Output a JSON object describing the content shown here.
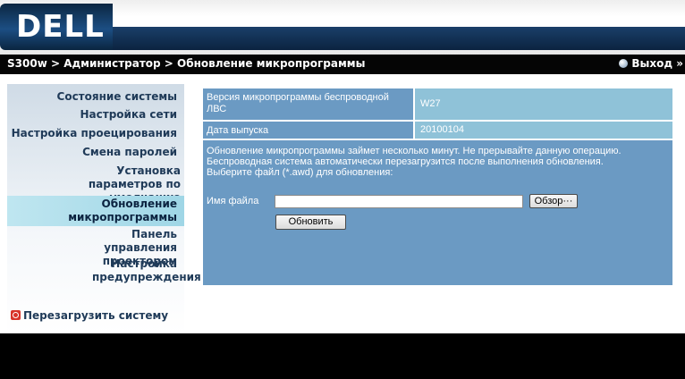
{
  "header": {
    "logo_text": "D&#x2C7;LL",
    "brand": "DELL"
  },
  "breadcrumb": "S300w > Администратор > Обновление микропрограммы",
  "logout_label": "Выход »",
  "sidebar": {
    "items": [
      {
        "label": "Состояние системы"
      },
      {
        "label": "Настройка сети"
      },
      {
        "label": "Настройка проецирования"
      },
      {
        "label": "Смена паролей"
      },
      {
        "label": "Установка параметров по умолчанию"
      },
      {
        "label": "Обновление микропрограммы",
        "active": true
      },
      {
        "label": "Панель управления проектором"
      },
      {
        "label": "Настройка предупреждения"
      }
    ],
    "restart_label": "Перезагрузить систему"
  },
  "firmware": {
    "version_label": "Версия микропрограммы беспроводной ЛВС",
    "version_value": "W27",
    "date_label": "Дата выпуска",
    "date_value": "20100104",
    "notice": "Обновление микропрограммы займет несколько минут. Не прерывайте данную операцию. Беспроводная система автоматически перезагрузится после выполнения обновления.",
    "select_prompt": "Выберите файл (*.awd) для обновления:",
    "file_label": "Имя файла",
    "file_value": "",
    "browse_label": "Обзор···",
    "update_label": "Обновить"
  },
  "colors": {
    "panel_dark": "#6b9ac3",
    "panel_light": "#8fc2d8",
    "header_blue": "#1c4e83",
    "active_item": "#9fd6e6"
  }
}
